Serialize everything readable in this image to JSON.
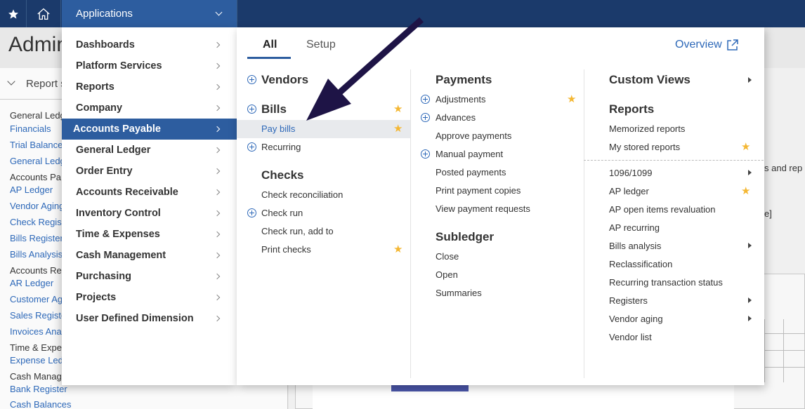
{
  "topbar": {
    "apps_label": "Applications",
    "icons": [
      "star-icon",
      "home-icon",
      "chevron-down-icon"
    ]
  },
  "background": {
    "page_title": "Admin",
    "report_section": "Report s",
    "left_items": [
      {
        "text": "General Ledg",
        "style": "hd"
      },
      {
        "text": "Financials",
        "style": "link"
      },
      {
        "text": "Trial Balance",
        "style": "link"
      },
      {
        "text": "General Ledg",
        "style": "link"
      },
      {
        "text": "Accounts Pa",
        "style": "hd"
      },
      {
        "text": "AP Ledger",
        "style": "link"
      },
      {
        "text": "Vendor Aging",
        "style": "link"
      },
      {
        "text": "Check Regis",
        "style": "link"
      },
      {
        "text": "Bills Register",
        "style": "link"
      },
      {
        "text": "Bills Analysis",
        "style": "link"
      },
      {
        "text": "Accounts Re",
        "style": "hd"
      },
      {
        "text": "AR Ledger",
        "style": "link"
      },
      {
        "text": "Customer Ag",
        "style": "link"
      },
      {
        "text": "Sales Registe",
        "style": "link"
      },
      {
        "text": "Invoices Ana",
        "style": "link"
      },
      {
        "text": "Time & Expe",
        "style": "hd"
      },
      {
        "text": "Expense Led",
        "style": "link"
      },
      {
        "text": "Cash Manag",
        "style": "hd"
      },
      {
        "text": "Bank Register",
        "style": "link"
      },
      {
        "text": "Cash Balances",
        "style": "link"
      }
    ],
    "right_text_1": "s and rep",
    "right_text_2": "e]"
  },
  "menu": {
    "categories": [
      {
        "label": "Dashboards",
        "active": false
      },
      {
        "label": "Platform Services",
        "active": false
      },
      {
        "label": "Reports",
        "active": false
      },
      {
        "label": "Company",
        "active": false
      },
      {
        "label": "Accounts Payable",
        "active": true
      },
      {
        "label": "General Ledger",
        "active": false
      },
      {
        "label": "Order Entry",
        "active": false
      },
      {
        "label": "Accounts Receivable",
        "active": false
      },
      {
        "label": "Inventory Control",
        "active": false
      },
      {
        "label": "Time & Expenses",
        "active": false
      },
      {
        "label": "Cash Management",
        "active": false
      },
      {
        "label": "Purchasing",
        "active": false
      },
      {
        "label": "Projects",
        "active": false
      },
      {
        "label": "User Defined Dimension",
        "active": false
      }
    ],
    "tabs": [
      {
        "label": "All",
        "active": true
      },
      {
        "label": "Setup",
        "active": false
      }
    ],
    "overview_label": "Overview",
    "col1": {
      "vendors": "Vendors",
      "bills": "Bills",
      "pay_bills": "Pay bills",
      "recurring": "Recurring",
      "checks": "Checks",
      "check_reconciliation": "Check reconciliation",
      "check_run": "Check run",
      "check_run_add_to": "Check run, add to",
      "print_checks": "Print checks"
    },
    "col2": {
      "payments": "Payments",
      "adjustments": "Adjustments",
      "advances": "Advances",
      "approve_payments": "Approve payments",
      "manual_payment": "Manual payment",
      "posted_payments": "Posted payments",
      "print_payment_copies": "Print payment copies",
      "view_payment_requests": "View payment requests",
      "subledger": "Subledger",
      "close": "Close",
      "open": "Open",
      "summaries": "Summaries"
    },
    "col3": {
      "custom_views": "Custom Views",
      "reports": "Reports",
      "memorized_reports": "Memorized reports",
      "my_stored_reports": "My stored reports",
      "r_1096": "1096/1099",
      "ap_ledger": "AP ledger",
      "ap_open_items": "AP open items revaluation",
      "ap_recurring": "AP recurring",
      "bills_analysis": "Bills analysis",
      "reclassification": "Reclassification",
      "recurring_status": "Recurring transaction status",
      "registers": "Registers",
      "vendor_aging": "Vendor aging",
      "vendor_list": "Vendor list"
    }
  },
  "colors": {
    "topbar": "#1b3a6b",
    "accent": "#2d5d9f",
    "link": "#2d68b8",
    "star": "#f4b733",
    "arrow": "#1e1446"
  }
}
